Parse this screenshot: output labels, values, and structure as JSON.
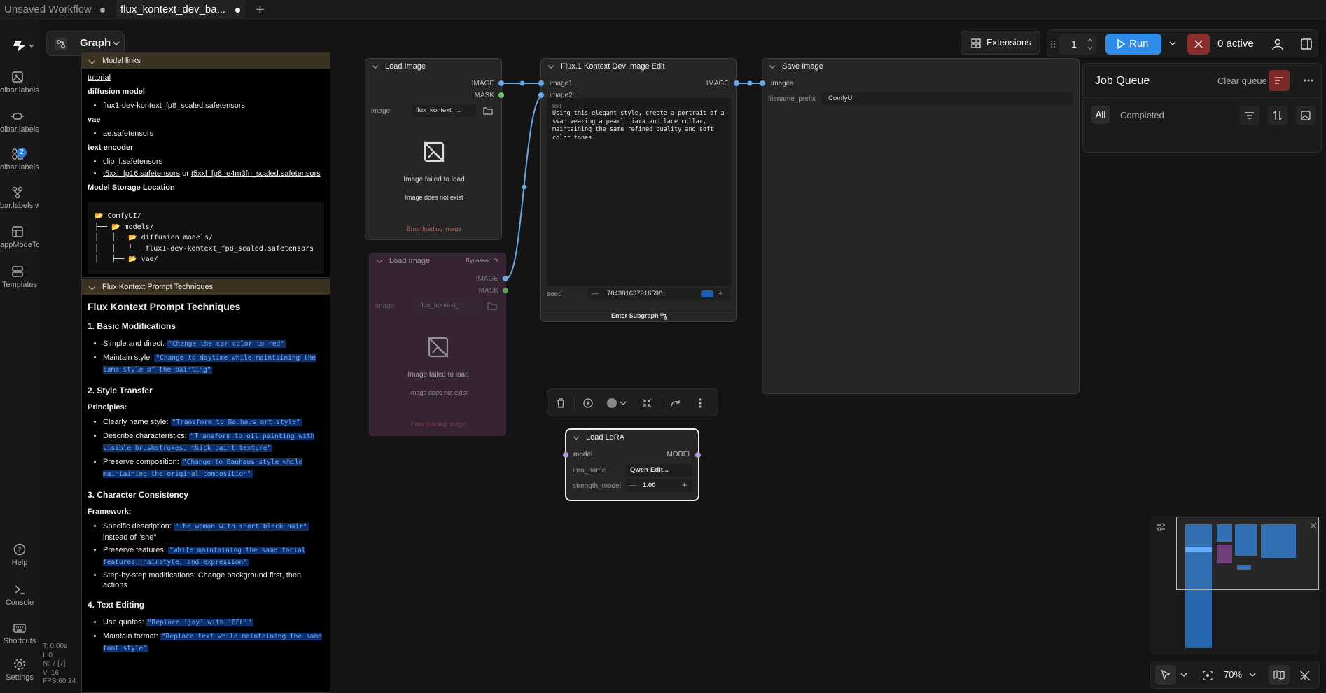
{
  "tabs": [
    {
      "label": "Unsaved Workflow"
    },
    {
      "label": "flux_kontext_dev_ba..."
    }
  ],
  "sidebar": {
    "items": [
      {
        "label": "olbar.labels.",
        "icon": "images-icon"
      },
      {
        "label": "olbar.labels.",
        "icon": "model-link-icon"
      },
      {
        "label": "olbar.labels.",
        "icon": "nodes-icon",
        "badge": "2"
      },
      {
        "label": "bar.labels.w",
        "icon": "workflow-icon"
      },
      {
        "label": "appModeTo",
        "icon": "app-mode-icon"
      },
      {
        "label": "Templates",
        "icon": "templates-icon"
      }
    ],
    "bottom": [
      {
        "label": "Help",
        "icon": "help-icon"
      },
      {
        "label": "Console",
        "icon": "console-icon"
      },
      {
        "label": "Shortcuts",
        "icon": "keyboard-icon"
      },
      {
        "label": "Settings",
        "icon": "gear-icon"
      }
    ]
  },
  "stats": {
    "t": "T: 0.00s",
    "i": "I: 0",
    "n": "N: 7 [7]",
    "v": "V: 16",
    "fps": "FPS:60.24"
  },
  "graph": {
    "label": "Graph"
  },
  "toolbar": {
    "extensions": "Extensions",
    "batch": "1",
    "run": "Run",
    "active": "0 active"
  },
  "queue": {
    "title": "Job Queue",
    "clear": "Clear queue",
    "tab_all": "All",
    "tab_completed": "Completed"
  },
  "model_links": {
    "title": "Model links",
    "tutorial": "tutorial",
    "h_diffusion": "diffusion model",
    "diffusion_file": "flux1-dev-kontext_fp8_scaled.safetensors",
    "h_vae": "vae",
    "vae_file": "ae.safetensors",
    "h_text": "text encoder",
    "clip_file": "clip_l.safetensors",
    "t5_a": "t5xxl_fp16.safetensors",
    "or": " or ",
    "t5_b": "t5xxl_fp8_e4m3fn_scaled.safetensors",
    "storage": "Model Storage Location",
    "tree": [
      "📂 ComfyUI/",
      "├── 📂 models/",
      "│   ├── 📂 diffusion_models/",
      "│   │   └── flux1-dev-kontext_fp8_scaled.safetensors",
      "│   ├── 📂 vae/"
    ]
  },
  "techniques": {
    "title": "Flux Kontext Prompt Techniques",
    "h": "Flux Kontext Prompt Techniques",
    "s1": "1. Basic Modifications",
    "s1a": "Simple and direct:",
    "s1a_c": "\"Change the car color to red\"",
    "s1b": "Maintain style:",
    "s1b_c": "\"Change to daytime while maintaining the same style of the painting\"",
    "s2": "2. Style Transfer",
    "principles": "Principles:",
    "s2a": "Clearly name style:",
    "s2a_c": "\"Transform to Bauhaus art style\"",
    "s2b": "Describe characteristics:",
    "s2b_c": "\"Transform to oil painting with visible brushstrokes, thick paint texture\"",
    "s2c": "Preserve composition:",
    "s2c_c": "\"Change to Bauhaus style while maintaining the original composition\"",
    "s3": "3. Character Consistency",
    "framework": "Framework:",
    "s3a": "Specific description:",
    "s3a_c": "\"The woman with short black hair\"",
    "s3a_t": "instead of \"she\"",
    "s3b": "Preserve features:",
    "s3b_c": "\"while maintaining the same facial features, hairstyle, and expression\"",
    "s3c": "Step-by-step modifications: Change background first, then actions",
    "s4": "4. Text Editing",
    "s4a": "Use quotes:",
    "s4a_c": "\"Replace 'joy' with 'BFL'\"",
    "s4b": "Maintain format:",
    "s4b_c": "\"Replace text while maintaining the same font style\""
  },
  "load_image": {
    "title": "Load Image",
    "out_image": "IMAGE",
    "out_mask": "MASK",
    "image_label": "image",
    "image_value": "flux_kontext_...",
    "fail": "Image failed to load",
    "missing": "Image does not exist",
    "error": "Error loading image"
  },
  "load_image_b": {
    "title": "Load Image",
    "bypassed": "Bypassed",
    "out_image": "IMAGE",
    "out_mask": "MASK",
    "image_label": "image",
    "image_value": "flux_kontext_...",
    "fail": "Image failed to load",
    "missing": "Image does not exist",
    "error": "Error loading image"
  },
  "flux": {
    "title": "Flux.1 Kontext Dev Image Edit",
    "in1": "image1",
    "in2": "image2",
    "out": "IMAGE",
    "text_label": "text",
    "prompt": "Using this elegant style, create a portrait of a swan wearing a pearl tiara and lace collar, maintaining the same refined quality and soft color tones.",
    "seed_label": "seed",
    "seed": "784381637916598",
    "subgraph": "Enter Subgraph"
  },
  "save": {
    "title": "Save Image",
    "in": "images",
    "prefix_label": "filename_prefix",
    "prefix": "ComfyUI"
  },
  "lora": {
    "title": "Load LoRA",
    "in": "model",
    "out": "MODEL",
    "name_label": "lora_name",
    "name": "Qwen-Edit...",
    "strength_label": "strength_model",
    "strength": "1.00"
  },
  "zoom": "70%"
}
